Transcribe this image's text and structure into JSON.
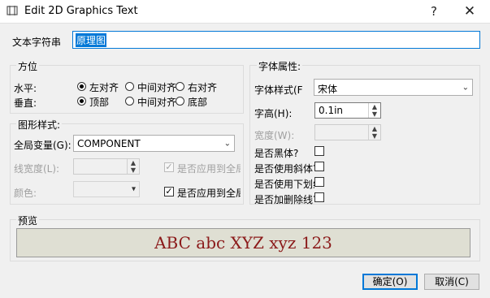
{
  "window": {
    "title": "Edit 2D Graphics Text",
    "help": "?",
    "close": "✕"
  },
  "text_string": {
    "label": "文本字符串",
    "value": "原理图"
  },
  "position": {
    "title": "方位",
    "horizontal_label": "水平:",
    "vertical_label": "垂直:",
    "h_options": [
      "左对齐",
      "中间对齐",
      "右对齐"
    ],
    "h_selected": 0,
    "v_options": [
      "顶部",
      "中间对齐",
      "底部"
    ],
    "v_selected": 0
  },
  "graphic_style": {
    "title": "图形样式:",
    "global_var_label": "全局变量(G):",
    "global_var_value": "COMPONENT",
    "line_width_label": "线宽度(L):",
    "line_width_value": "",
    "color_label": "颜色:",
    "color_value": "",
    "apply_all_1": "是否应用到全局",
    "apply_all_1_checked": true,
    "apply_all_2": "是否应用到全局",
    "apply_all_2_checked": true
  },
  "font_props": {
    "title": "字体属性:",
    "font_style_label": "字体样式(F",
    "font_style_value": "宋体",
    "font_height_label": "字高(H):",
    "font_height_value": "0.1in",
    "width_label": "宽度(W):",
    "width_value": "",
    "bold_label": "是否黑体?",
    "bold_checked": false,
    "italic_label": "是否使用斜体?",
    "italic_checked": false,
    "underline_label": "是否使用下划线",
    "underline_checked": false,
    "strike_label": "是否加删除线?",
    "strike_checked": false
  },
  "preview": {
    "title": "预览",
    "text": "ABC abc XYZ xyz 123"
  },
  "buttons": {
    "ok": "确定(O)",
    "cancel": "取消(C)"
  },
  "colors": {
    "preview_bg": "#dfdfd3",
    "preview_text": "#8b1a1a",
    "accent": "#0078d7"
  }
}
